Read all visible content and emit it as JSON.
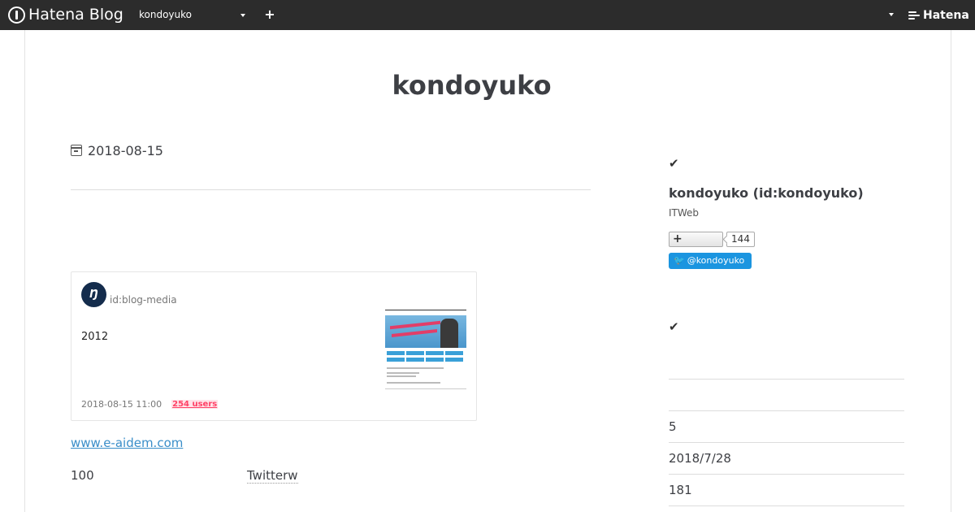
{
  "topbar": {
    "logo_text": "Hatena Blog",
    "blog_select": "kondoyuko",
    "add_label": "+",
    "hatena_text": "Hatena"
  },
  "blog": {
    "title": "kondoyuko"
  },
  "entry": {
    "date": "2018-08-15",
    "embed": {
      "avatar_text": "Ŋ",
      "author": "id:blog-media",
      "title": "2012",
      "timestamp": "2018-08-15 11:00",
      "users": "254 users"
    },
    "link_text": "www.e-aidem.com",
    "text_1": "100",
    "text_2": "Twitterw"
  },
  "sidebar": {
    "check_glyph": "✔",
    "profile_name": "kondoyuko (id:kondoyuko)",
    "profile_desc": "ITWeb",
    "follow_label": "+",
    "follow_count": "144",
    "twitter_handle": "@kondoyuko",
    "items": [
      {
        "label": "5"
      },
      {
        "label": " 2018/7/28"
      },
      {
        "label": "181"
      }
    ]
  },
  "colors": {
    "topbar_bg": "#2c2c2c",
    "link": "#3a8ec9",
    "users_badge": "#ff4166",
    "twitter": "#1b95e0"
  }
}
